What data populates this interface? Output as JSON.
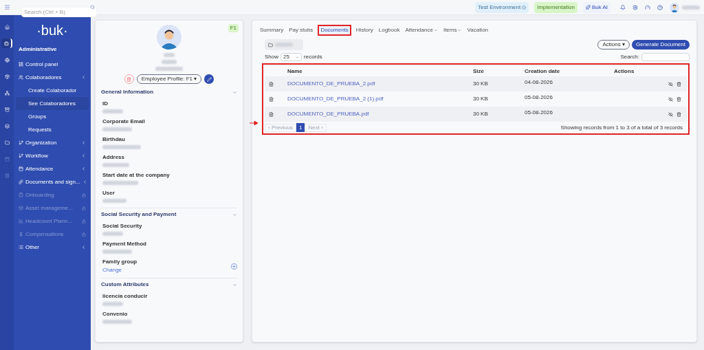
{
  "topbar": {
    "search": {
      "placeholder": "Search (Ctrl + B)"
    },
    "badges": [
      {
        "kind": "env",
        "label": "Test Environment"
      },
      {
        "kind": "impl",
        "label": "Implementation"
      },
      {
        "kind": "ai",
        "label": "Buk AI"
      }
    ]
  },
  "rail": [
    {
      "selected": false
    },
    {
      "selected": true
    },
    {
      "selected": false
    },
    {
      "selected": false
    },
    {
      "selected": false
    },
    {
      "selected": false
    },
    {
      "selected": false
    },
    {
      "selected": false
    },
    {
      "selected": false
    },
    {
      "selected": false
    }
  ],
  "sidebar": {
    "logo": "·buk·",
    "section": "Administrative",
    "items": [
      {
        "label": "Control panel",
        "submenu": false,
        "locked": false
      },
      {
        "label": "Colaboradores",
        "submenu": true,
        "locked": false,
        "children": [
          {
            "label": "Create Colaborador",
            "selected": false
          },
          {
            "label": "See Colaboradores",
            "selected": true
          },
          {
            "label": "Groups",
            "selected": false
          },
          {
            "label": "Requests",
            "selected": false
          }
        ]
      },
      {
        "label": "Organization",
        "submenu": true,
        "locked": false
      },
      {
        "label": "Workflow",
        "submenu": true,
        "locked": false
      },
      {
        "label": "Attendance",
        "submenu": true,
        "locked": false
      },
      {
        "label": "Documents and sign...",
        "submenu": true,
        "locked": false
      },
      {
        "label": "Onboarding",
        "submenu": false,
        "locked": true
      },
      {
        "label": "Asset manageme...",
        "submenu": false,
        "locked": true
      },
      {
        "label": "Headcount Plann...",
        "submenu": false,
        "locked": true
      },
      {
        "label": "Compensations",
        "submenu": false,
        "locked": true
      },
      {
        "label": "Other",
        "submenu": true,
        "locked": false
      }
    ]
  },
  "profile": {
    "badge": "F1",
    "profile_button": "Employee Profile: F1 ▾",
    "sections": [
      {
        "title": "General Information",
        "fields": [
          {
            "label": "ID"
          },
          {
            "label": "Corporate Email"
          },
          {
            "label": "Birthdau"
          },
          {
            "label": "Address"
          },
          {
            "label": "Start date at the company"
          },
          {
            "label": "User"
          }
        ]
      },
      {
        "title": "Social Security and Payment",
        "fields": [
          {
            "label": "Social Security"
          },
          {
            "label": "Payment Method"
          },
          {
            "label": "Family group",
            "link": "Change"
          }
        ]
      },
      {
        "title": "Custom Attributes",
        "fields": [
          {
            "label": "licencia conducir"
          },
          {
            "label": "Convenio"
          }
        ]
      }
    ]
  },
  "tabs": [
    {
      "label": "Summary",
      "selected": false,
      "dropdown": false
    },
    {
      "label": "Pay stubs",
      "selected": false,
      "dropdown": false
    },
    {
      "label": "Documents",
      "selected": true,
      "dropdown": false
    },
    {
      "label": "History",
      "selected": false,
      "dropdown": false
    },
    {
      "label": "Logbook",
      "selected": false,
      "dropdown": false
    },
    {
      "label": "Attendance",
      "selected": false,
      "dropdown": true
    },
    {
      "label": "Items",
      "selected": false,
      "dropdown": true
    },
    {
      "label": "Vacation",
      "selected": false,
      "dropdown": false
    }
  ],
  "toolbar": {
    "actions": "Actions ▾",
    "generate": "Generate Document",
    "show": "Show",
    "page_size": "25",
    "records": "records",
    "search_label": "Search:"
  },
  "table": {
    "columns": [
      "Name",
      "Size",
      "Creation date",
      "Actions"
    ],
    "rows": [
      {
        "name": "DOCUMENTO_DE_PRUEBA_2.pdf",
        "size": "30 KB",
        "date": "04-08-2026"
      },
      {
        "name": "DOCUMENTO_DE_PRUEBA_2 (1).pdf",
        "size": "30 KB",
        "date": "05-08-2026"
      },
      {
        "name": "DOCUMENTO_DE_PRUEBA.pdf",
        "size": "30 KB",
        "date": "05-08-2026"
      }
    ]
  },
  "pagination": {
    "previous": "‹ Previous",
    "pages": [
      {
        "label": "1",
        "selected": true
      }
    ],
    "next": "Next ›",
    "summary": "Showing records from 1 to 3 of a total of 3 records"
  }
}
